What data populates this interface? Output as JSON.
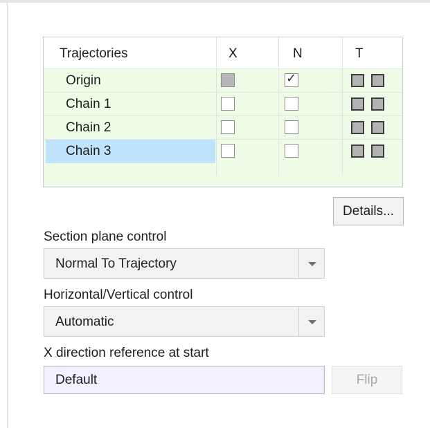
{
  "trajectories": {
    "headers": {
      "name": "Trajectories",
      "x": "X",
      "n": "N",
      "t": "T"
    },
    "rows": [
      {
        "name": "Origin",
        "x": "disabled",
        "n": "checked",
        "selected": false
      },
      {
        "name": "Chain 1",
        "x": "unchecked",
        "n": "unchecked",
        "selected": false
      },
      {
        "name": "Chain 2",
        "x": "unchecked",
        "n": "unchecked",
        "selected": false
      },
      {
        "name": "Chain 3",
        "x": "unchecked",
        "n": "unchecked",
        "selected": true
      }
    ]
  },
  "details_button": "Details...",
  "section_plane": {
    "label": "Section plane control",
    "value": "Normal To Trajectory"
  },
  "hv_control": {
    "label": "Horizontal/Vertical control",
    "value": "Automatic"
  },
  "x_direction": {
    "label": "X direction reference at start",
    "value": "Default"
  },
  "flip_button": "Flip",
  "checkmark_glyph": "✓",
  "colors": {
    "table_bg": "#eefbe7",
    "selection": "#bfe3fb",
    "field_bg": "#f3efff",
    "disabled_text": "#a8a8a8"
  }
}
